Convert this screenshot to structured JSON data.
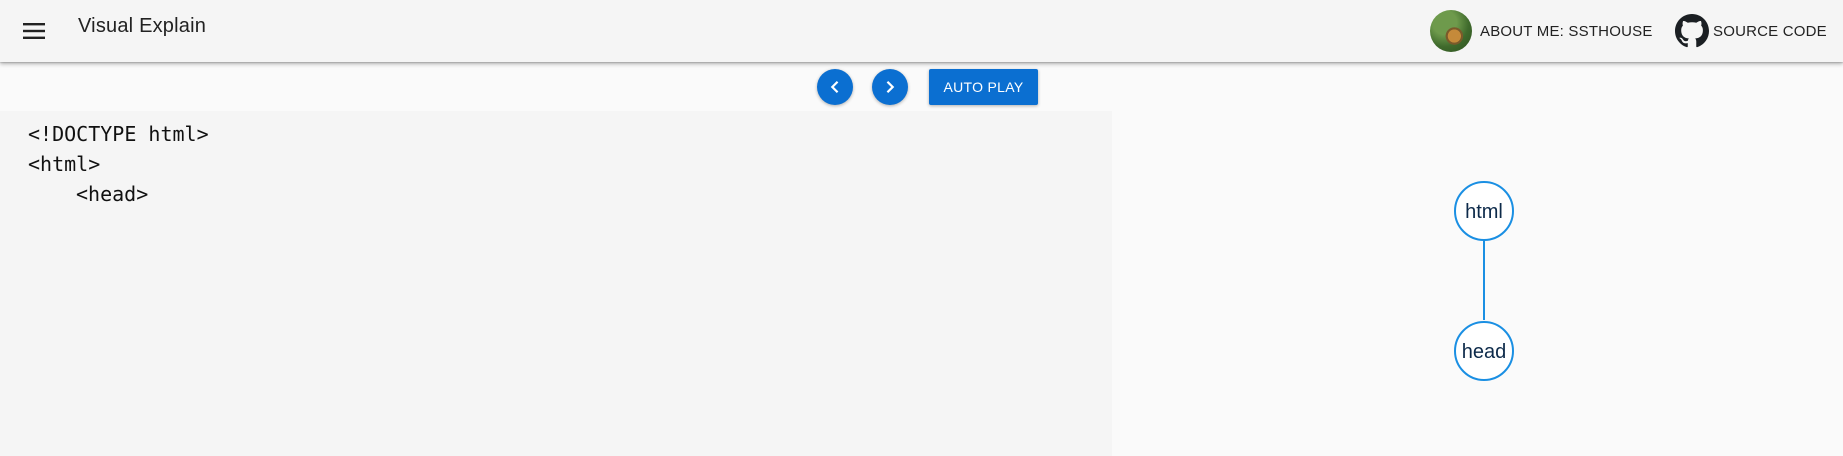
{
  "header": {
    "menu_icon": "menu-icon",
    "title": "Visual Explain",
    "about_label": "ABOUT ME: SSTHOUSE",
    "source_label": "SOURCE CODE",
    "source_icon": "github-icon"
  },
  "controls": {
    "prev_icon": "chevron-left-icon",
    "next_icon": "chevron-right-icon",
    "autoplay_label": "AUTO PLAY",
    "accent_color": "#0b6fd1"
  },
  "code": {
    "lines": [
      "<!DOCTYPE html>",
      "<html>",
      "<head>"
    ]
  },
  "tree": {
    "node_color": "#1a8fe3",
    "nodes": [
      {
        "label": "html"
      },
      {
        "label": "head"
      }
    ],
    "edges": [
      {
        "from": "html",
        "to": "head"
      }
    ]
  }
}
